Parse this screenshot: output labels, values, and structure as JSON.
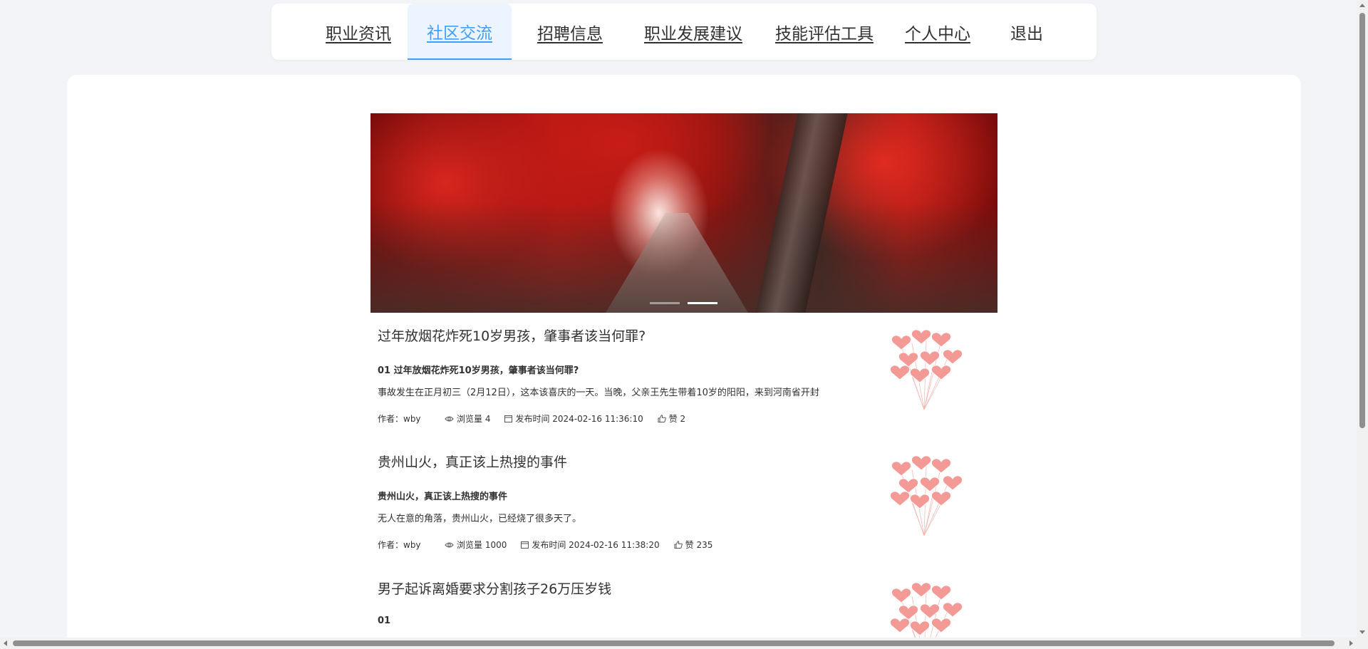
{
  "nav": {
    "items": [
      {
        "label": "职业资讯"
      },
      {
        "label": "社区交流",
        "active": true
      },
      {
        "label": "招聘信息"
      },
      {
        "label": "职业发展建议"
      },
      {
        "label": "技能评估工具"
      },
      {
        "label": "个人中心"
      },
      {
        "label": "退出"
      }
    ]
  },
  "carousel": {
    "slide_count": 2,
    "active_index": 1
  },
  "articles": [
    {
      "title": "过年放烟花炸死10岁男孩，肇事者该当何罪?",
      "subtitle": "01 过年放烟花炸死10岁男孩，肇事者该当何罪?",
      "excerpt": "事故发生在正月初三（2月12日），这本该喜庆的一天。当晚，父亲王先生带着10岁的阳阳，来到河南省开封",
      "author": "作者：wby",
      "views": "浏览量 4",
      "published": "发布时间 2024-02-16 11:36:10",
      "likes": "赞 2"
    },
    {
      "title": "贵州山火，真正该上热搜的事件",
      "subtitle": "贵州山火，真正该上热搜的事件",
      "excerpt": "无人在意的角落，贵州山火，已经烧了很多天了。",
      "author": "作者：wby",
      "views": "浏览量 1000",
      "published": "发布时间 2024-02-16 11:38:20",
      "likes": "赞 235"
    },
    {
      "title": "男子起诉离婚要求分割孩子26万压岁钱",
      "subtitle": "01",
      "excerpt": "",
      "author": "",
      "views": "",
      "published": "",
      "likes": ""
    }
  ],
  "icons": {
    "views": "eye-icon",
    "published": "calendar-icon",
    "likes": "thumbs-up-icon",
    "thumbnail": "heart-balloons"
  },
  "colors": {
    "accent": "#409eff",
    "page_bg": "#f2f4f8",
    "card_bg": "#ffffff",
    "text": "#303133"
  }
}
